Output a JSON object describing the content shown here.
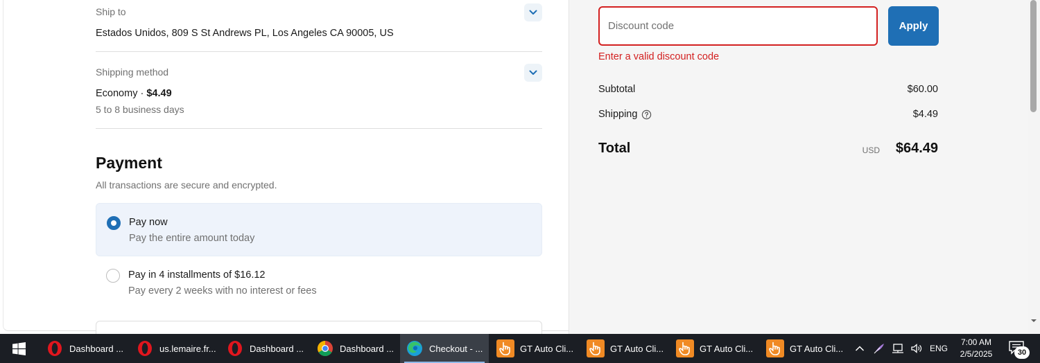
{
  "shipping": {
    "ship_to_label": "Ship to",
    "ship_to_value": "Estados Unidos, 809 S St Andrews PL, Los Angeles CA 90005, US",
    "method_label": "Shipping method",
    "method_name": "Economy · ",
    "method_price": "$4.49",
    "method_eta": "5 to 8 business days"
  },
  "payment": {
    "title": "Payment",
    "subtitle": "All transactions are secure and encrypted.",
    "options": [
      {
        "title": "Pay now",
        "subtitle": "Pay the entire amount today",
        "selected": true
      },
      {
        "title": "Pay in 4 installments of $16.12",
        "subtitle": "Pay every 2 weeks with no interest or fees",
        "selected": false
      }
    ]
  },
  "summary": {
    "discount_placeholder": "Discount code",
    "discount_value": "",
    "apply_label": "Apply",
    "discount_error": "Enter a valid discount code",
    "subtotal_label": "Subtotal",
    "subtotal_value": "$60.00",
    "shipping_label": "Shipping",
    "shipping_value": "$4.49",
    "total_label": "Total",
    "total_currency": "USD",
    "total_value": "$64.49"
  },
  "taskbar": {
    "items": [
      {
        "label": "Dashboard ...",
        "icon": "opera-icon"
      },
      {
        "label": "us.lemaire.fr...",
        "icon": "opera-icon"
      },
      {
        "label": "Dashboard ...",
        "icon": "opera-icon"
      },
      {
        "label": "Dashboard ...",
        "icon": "chrome-icon"
      },
      {
        "label": "Checkout - ...",
        "icon": "edge-icon",
        "active": true
      },
      {
        "label": "GT Auto Cli...",
        "icon": "hand-pointer-icon"
      },
      {
        "label": "GT Auto Cli...",
        "icon": "hand-pointer-icon"
      },
      {
        "label": "GT Auto Cli...",
        "icon": "hand-pointer-icon"
      },
      {
        "label": "GT Auto Cli...",
        "icon": "hand-pointer-icon"
      }
    ],
    "language": "ENG",
    "time": "7:00 AM",
    "date": "2/5/2025",
    "notification_count": "30"
  },
  "colors": {
    "accent": "#1f6fb5",
    "error": "#d32020",
    "selected_option_bg": "#eef3fb",
    "summary_bg": "#f5f5f5",
    "taskbar_bg": "#1b1e24"
  }
}
